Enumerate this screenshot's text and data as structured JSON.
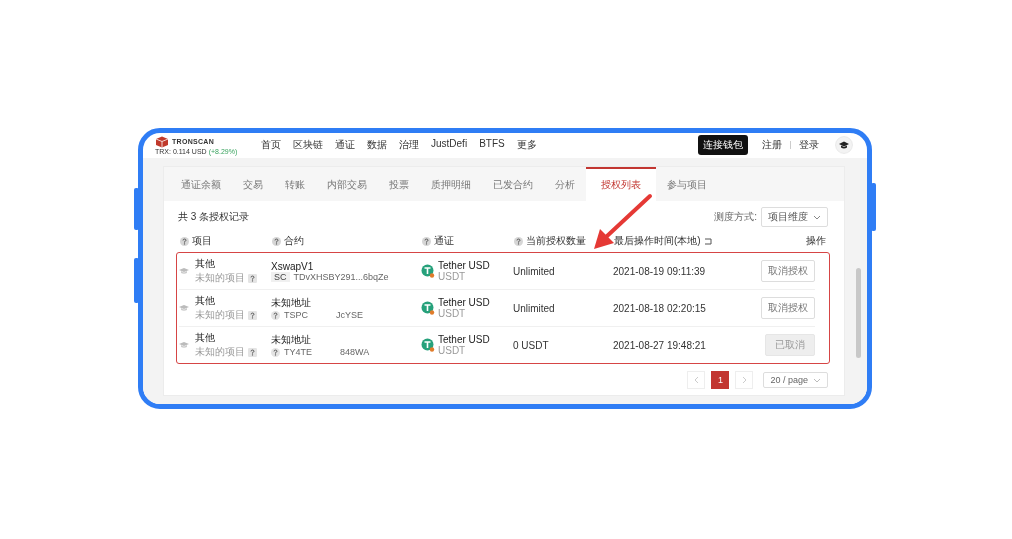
{
  "header": {
    "logo": "TRONSCAN",
    "price": "TRX: 0.114 USD",
    "change": "(+8.29%)",
    "nav": [
      "首页",
      "区块链",
      "通证",
      "数据",
      "治理",
      "JustDefi",
      "BTFS",
      "更多"
    ],
    "connect_button": "连接钱包",
    "register": "注册",
    "login": "登录"
  },
  "tabs": [
    {
      "label": "通证余额",
      "selected": false
    },
    {
      "label": "交易",
      "selected": false
    },
    {
      "label": "转账",
      "selected": false
    },
    {
      "label": "内部交易",
      "selected": false
    },
    {
      "label": "投票",
      "selected": false
    },
    {
      "label": "质押明细",
      "selected": false
    },
    {
      "label": "已发合约",
      "selected": false
    },
    {
      "label": "分析",
      "selected": false
    },
    {
      "label": "授权列表",
      "selected": true
    },
    {
      "label": "参与项目",
      "selected": false
    }
  ],
  "record_count": "共 3 条授权记录",
  "sort": {
    "label": "测度方式:",
    "value": "项目维度"
  },
  "table": {
    "columns": [
      {
        "label": "项目",
        "kind": "help"
      },
      {
        "label": "合约",
        "kind": "help"
      },
      {
        "label": "通证",
        "kind": "help"
      },
      {
        "label": "当前授权数量",
        "kind": "help"
      },
      {
        "label": "最后操作时间(本地)",
        "kind": "sortable"
      },
      {
        "label": "操作",
        "kind": "plain"
      }
    ],
    "rows": [
      {
        "project": "其他",
        "project_note": "未知的项目",
        "contract": "XswapV1",
        "badge": {
          "kind": "sc",
          "text": "SC"
        },
        "address": [
          "TDvXHSBY291...6bqZe"
        ],
        "token": "Tether USD",
        "symbol": "USDT",
        "amount": "Unlimited",
        "time": "2021-08-19 09:11:39",
        "action": {
          "label": "取消授权",
          "disabled": false
        }
      },
      {
        "project": "其他",
        "project_note": "未知的项目",
        "contract": "未知地址",
        "badge": {
          "kind": "help"
        },
        "address": [
          "TSPC",
          "JcYSE"
        ],
        "token": "Tether USD",
        "symbol": "USDT",
        "amount": "Unlimited",
        "time": "2021-08-18 02:20:15",
        "action": {
          "label": "取消授权",
          "disabled": false
        }
      },
      {
        "project": "其他",
        "project_note": "未知的项目",
        "contract": "未知地址",
        "badge": {
          "kind": "help"
        },
        "address": [
          "TY4TE",
          "848WA"
        ],
        "token": "Tether USD",
        "symbol": "USDT",
        "amount": "0 USDT",
        "time": "2021-08-27 19:48:21",
        "action": {
          "label": "已取消",
          "disabled": true
        }
      }
    ]
  },
  "pagination": {
    "pages": [
      {
        "label": "1",
        "selected": true
      }
    ],
    "page_size": "20 / page"
  }
}
